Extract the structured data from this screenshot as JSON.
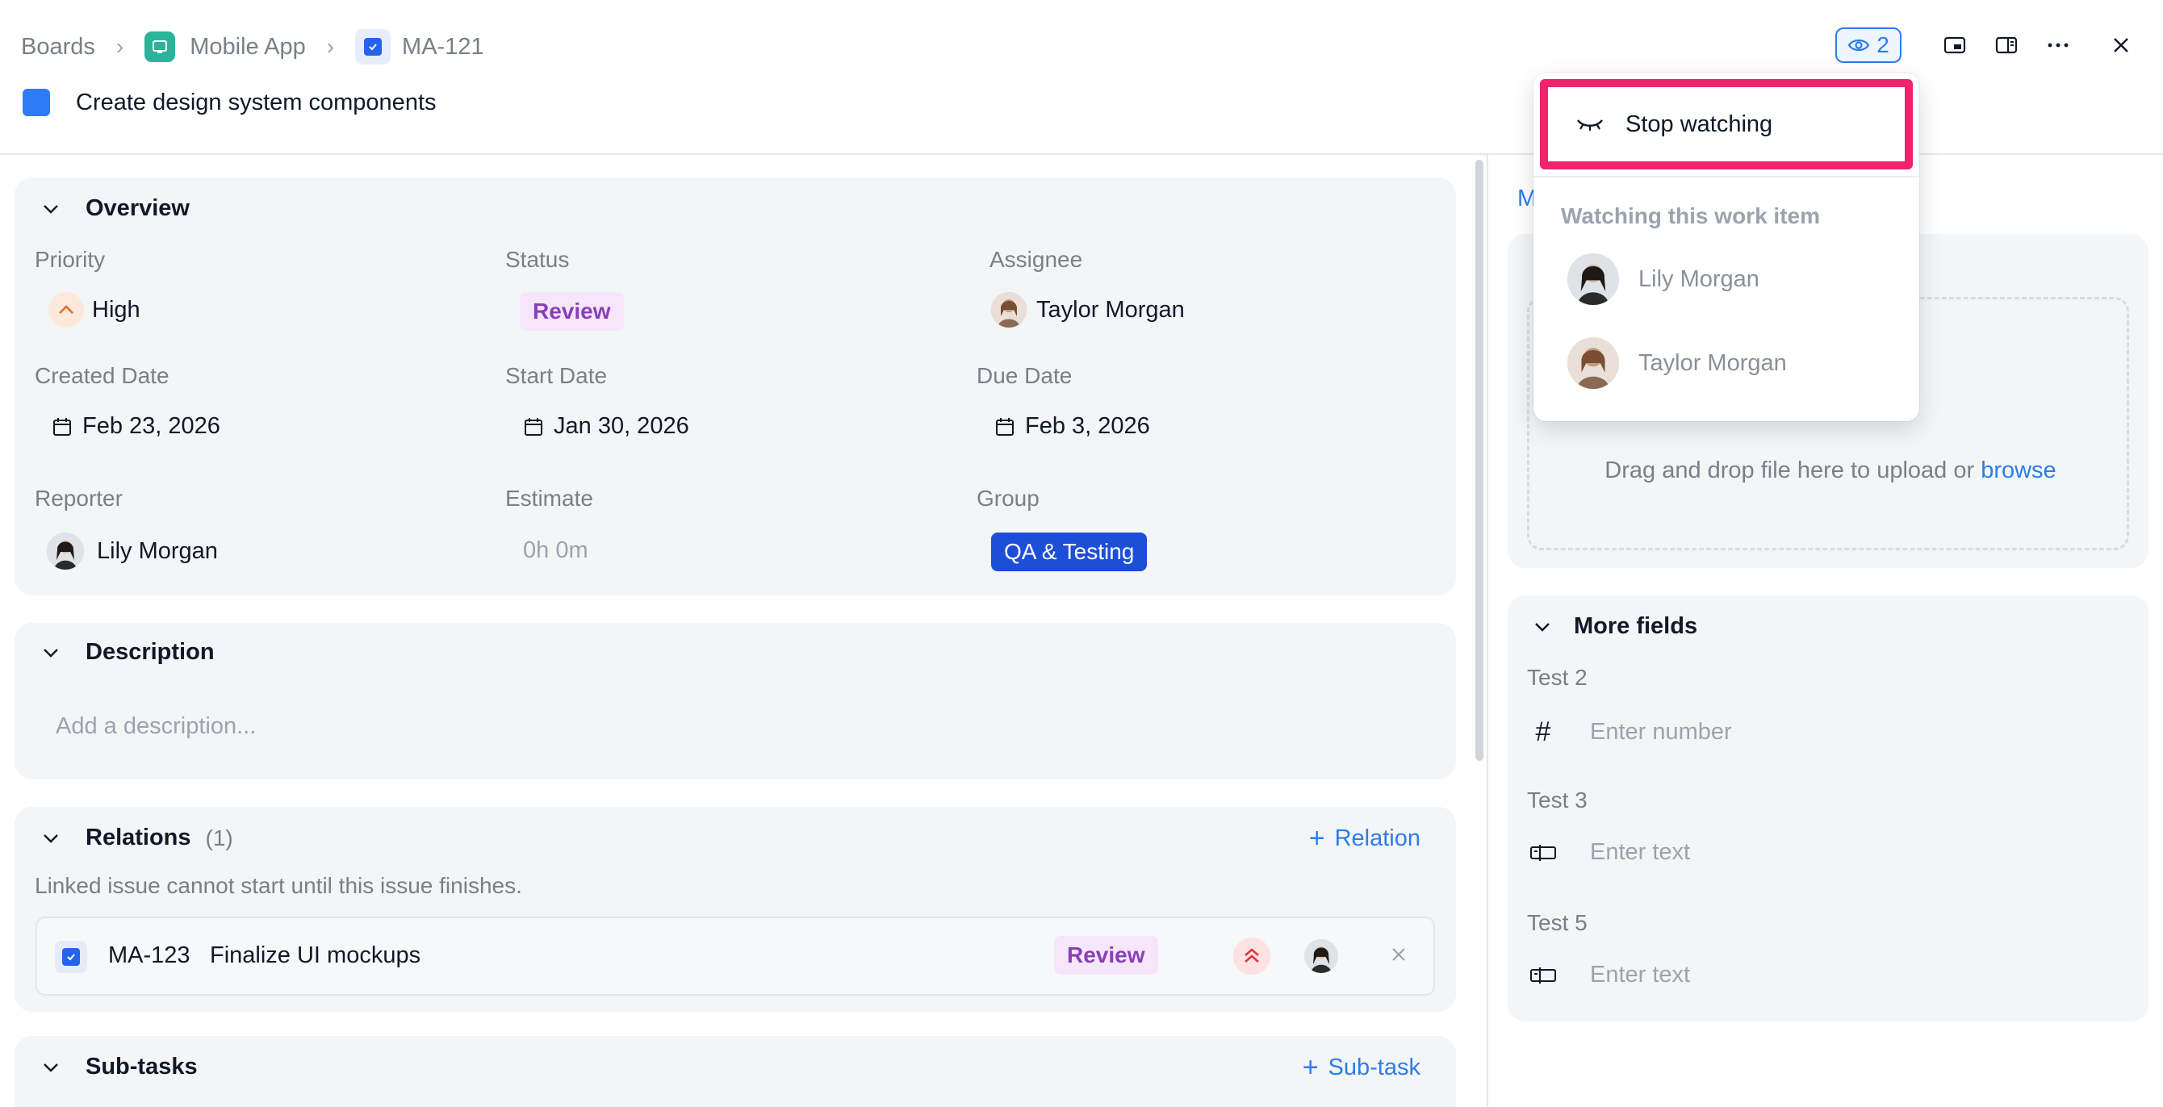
{
  "breadcrumb": {
    "root": "Boards",
    "project": "Mobile App",
    "item": "MA-121"
  },
  "task": {
    "title": "Create design system components"
  },
  "header": {
    "watchers_count": "2"
  },
  "watch_menu": {
    "stop_label": "Stop watching",
    "section_title": "Watching this work item",
    "watchers": [
      "Lily Morgan",
      "Taylor Morgan"
    ]
  },
  "overview": {
    "title": "Overview",
    "priority_label": "Priority",
    "priority_value": "High",
    "status_label": "Status",
    "status_value": "Review",
    "assignee_label": "Assignee",
    "assignee_value": "Taylor Morgan",
    "created_label": "Created Date",
    "created_value": "Feb 23, 2026",
    "start_label": "Start Date",
    "start_value": "Jan 30, 2026",
    "due_label": "Due Date",
    "due_value": "Feb 3, 2026",
    "reporter_label": "Reporter",
    "reporter_value": "Lily Morgan",
    "estimate_label": "Estimate",
    "estimate_value": "0h 0m",
    "group_label": "Group",
    "group_value": "QA & Testing"
  },
  "description": {
    "title": "Description",
    "placeholder": "Add a description..."
  },
  "relations": {
    "title": "Relations",
    "count": "(1)",
    "add_label": "Relation",
    "note": "Linked issue cannot start until this issue finishes.",
    "item_key": "MA-123",
    "item_title": "Finalize UI mockups",
    "item_status": "Review"
  },
  "subtasks": {
    "title": "Sub-tasks",
    "add_label": "Sub-task"
  },
  "right_panel": {
    "tab_partial": "M",
    "upload_text": "Drag and drop file here to upload or",
    "upload_link": "browse",
    "more_fields_title": "More fields",
    "fields": [
      {
        "label": "Test 2",
        "placeholder": "Enter number",
        "icon": "hash-icon"
      },
      {
        "label": "Test 3",
        "placeholder": "Enter text",
        "icon": "text-field-icon"
      },
      {
        "label": "Test 5",
        "placeholder": "Enter text",
        "icon": "text-field-icon"
      }
    ]
  },
  "colors": {
    "accent": "#2b7de9",
    "highlight": "#f0246b",
    "review": "#8a3fb8",
    "group": "#1d4ed8"
  }
}
